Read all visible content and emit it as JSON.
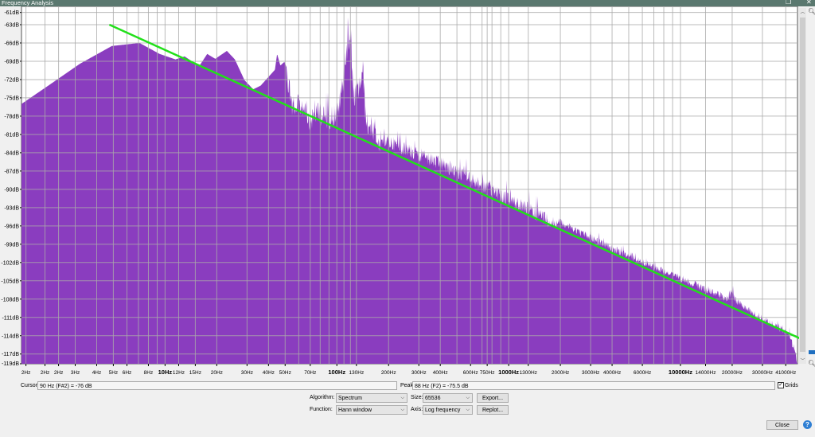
{
  "window": {
    "title": "Frequency Analysis",
    "restore_icon": "restore-icon",
    "close_icon": "close-icon"
  },
  "controls": {
    "cursor_label": "Cursor:",
    "cursor_value": "90 Hz (F#2) = -76 dB",
    "peak_label": "Peak:",
    "peak_value": "88 Hz (F2) = -75.5 dB",
    "grids_label": "Grids",
    "grids_checked": true,
    "algorithm_label": "Algorithm:",
    "algorithm_value": "Spectrum",
    "size_label": "Size:",
    "size_value": "65536",
    "export_label": "Export...",
    "function_label": "Function:",
    "function_value": "Hann window",
    "axis_label": "Axis:",
    "axis_value": "Log frequency",
    "replot_label": "Replot...",
    "close_label": "Close",
    "help_label": "?"
  },
  "chart_data": {
    "type": "area",
    "title": "Frequency Analysis",
    "xscale": "log",
    "xlim_hz": [
      1.46,
      48000
    ],
    "ylim_db": [
      -118.6,
      -60
    ],
    "grid": true,
    "fill_color": "#8a3dbf",
    "y_ticks": [
      {
        "label": "-61dB",
        "db": -61
      },
      {
        "label": "-63dB",
        "db": -63
      },
      {
        "label": "-66dB",
        "db": -66
      },
      {
        "label": "-69dB",
        "db": -69
      },
      {
        "label": "-72dB",
        "db": -72
      },
      {
        "label": "-75dB",
        "db": -75
      },
      {
        "label": "-78dB",
        "db": -78
      },
      {
        "label": "-81dB",
        "db": -81
      },
      {
        "label": "-84dB",
        "db": -84
      },
      {
        "label": "-87dB",
        "db": -87
      },
      {
        "label": "-90dB",
        "db": -90
      },
      {
        "label": "-93dB",
        "db": -93
      },
      {
        "label": "-96dB",
        "db": -96
      },
      {
        "label": "-99dB",
        "db": -99
      },
      {
        "label": "-102dB",
        "db": -102
      },
      {
        "label": "-105dB",
        "db": -105
      },
      {
        "label": "-108dB",
        "db": -108
      },
      {
        "label": "-111dB",
        "db": -111
      },
      {
        "label": "-114dB",
        "db": -114
      },
      {
        "label": "-117dB",
        "db": -117
      },
      {
        "label": "-119dB",
        "db": -118.6
      }
    ],
    "x_ticks": [
      {
        "label": "2Hz",
        "hz": 1.55
      },
      {
        "label": "2Hz",
        "hz": 2.0
      },
      {
        "label": "2Hz",
        "hz": 2.4
      },
      {
        "label": "3Hz",
        "hz": 3
      },
      {
        "label": "4Hz",
        "hz": 4
      },
      {
        "label": "5Hz",
        "hz": 5
      },
      {
        "label": "6Hz",
        "hz": 6
      },
      {
        "label": "8Hz",
        "hz": 8
      },
      {
        "label": "10Hz",
        "hz": 10,
        "bold": true
      },
      {
        "label": "12Hz",
        "hz": 12
      },
      {
        "label": "15Hz",
        "hz": 15
      },
      {
        "label": "20Hz",
        "hz": 20
      },
      {
        "label": "30Hz",
        "hz": 30
      },
      {
        "label": "40Hz",
        "hz": 40
      },
      {
        "label": "50Hz",
        "hz": 50
      },
      {
        "label": "70Hz",
        "hz": 70
      },
      {
        "label": "100Hz",
        "hz": 100,
        "bold": true
      },
      {
        "label": "130Hz",
        "hz": 130
      },
      {
        "label": "200Hz",
        "hz": 200
      },
      {
        "label": "300Hz",
        "hz": 300
      },
      {
        "label": "400Hz",
        "hz": 400
      },
      {
        "label": "600Hz",
        "hz": 600
      },
      {
        "label": "750Hz",
        "hz": 750
      },
      {
        "label": "1000Hz",
        "hz": 1000,
        "bold": true
      },
      {
        "label": "1300Hz",
        "hz": 1300
      },
      {
        "label": "2000Hz",
        "hz": 2000
      },
      {
        "label": "3000Hz",
        "hz": 3000
      },
      {
        "label": "4000Hz",
        "hz": 4000
      },
      {
        "label": "6000Hz",
        "hz": 6000
      },
      {
        "label": "10000Hz",
        "hz": 10000,
        "bold": true
      },
      {
        "label": "14000Hz",
        "hz": 14000
      },
      {
        "label": "20000Hz",
        "hz": 20000
      },
      {
        "label": "30000Hz",
        "hz": 30000
      },
      {
        "label": "41000Hz",
        "hz": 41000
      }
    ],
    "minor_grid_hz": [
      7,
      9,
      60,
      80,
      90,
      110,
      120,
      500,
      700,
      800,
      900,
      5000,
      7000,
      8000,
      9000
    ],
    "envelope": [
      [
        1.46,
        -76
      ],
      [
        2.09,
        -73
      ],
      [
        3.2,
        -69.4
      ],
      [
        4.9,
        -66.5
      ],
      [
        7.1,
        -66
      ],
      [
        9.3,
        -67.8
      ],
      [
        11.5,
        -68.7
      ],
      [
        13.0,
        -68.2
      ],
      [
        15.8,
        -69.8
      ],
      [
        17.6,
        -67.8
      ],
      [
        19.6,
        -68.6
      ],
      [
        22.9,
        -67.3
      ],
      [
        25.5,
        -68.7
      ],
      [
        29.0,
        -72.1
      ],
      [
        32.6,
        -73.6
      ],
      [
        36,
        -73
      ],
      [
        43.6,
        -70.4
      ],
      [
        44.9,
        -67.8
      ],
      [
        46.9,
        -69.7
      ],
      [
        49.5,
        -69.1
      ],
      [
        53.2,
        -71.3
      ],
      [
        55.0,
        -74.6
      ],
      [
        63.2,
        -74.3
      ],
      [
        70.2,
        -76.6
      ],
      [
        78.1,
        -75.3
      ],
      [
        86.9,
        -76.6
      ],
      [
        102,
        -75.3
      ],
      [
        110,
        -69
      ],
      [
        120,
        -61.6
      ],
      [
        125,
        -73.3
      ],
      [
        136,
        -71
      ],
      [
        142,
        -68.7
      ],
      [
        148,
        -77
      ],
      [
        174,
        -79.8
      ],
      [
        184,
        -80.5
      ],
      [
        430,
        -85
      ],
      [
        1125,
        -91.2
      ],
      [
        1915,
        -94.5
      ],
      [
        4497,
        -99.8
      ],
      [
        10550,
        -104.3
      ],
      [
        19000,
        -107.4
      ],
      [
        20000,
        -106
      ],
      [
        21000,
        -107.6
      ],
      [
        30600,
        -110.7
      ],
      [
        42100,
        -113
      ],
      [
        46900,
        -116
      ],
      [
        48000,
        -118.6
      ]
    ],
    "overlay_line": {
      "color": "#22e01a",
      "from": [
        4.74,
        -63
      ],
      "to": [
        58000,
        -115.3
      ]
    }
  }
}
